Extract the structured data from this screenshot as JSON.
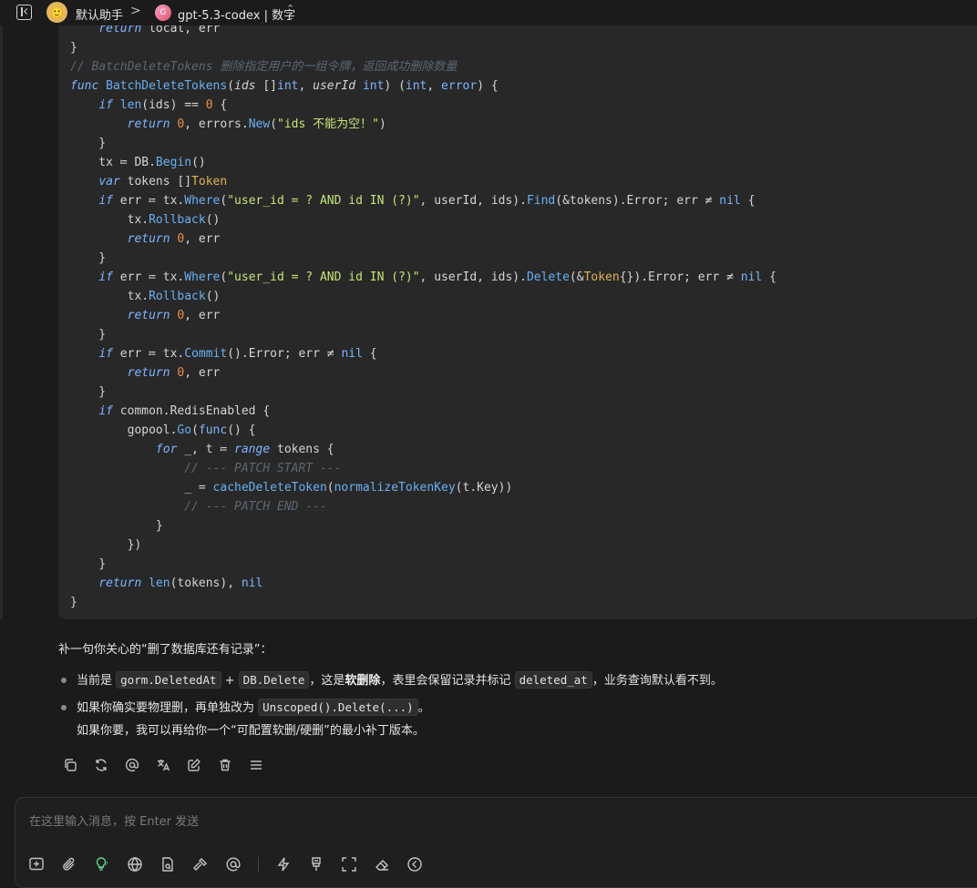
{
  "topbar": {
    "assistant_name": "默认助手",
    "separator": ">",
    "model_name": "gpt-5.3-codex | 数字",
    "model_icon_letter": "G"
  },
  "code": {
    "language": "go",
    "lines": [
      "    return local, err",
      "}",
      "// BatchDeleteTokens 删除指定用户的一组令牌，返回成功删除数量",
      "func BatchDeleteTokens(ids []int, userId int) (int, error) {",
      "    if len(ids) == 0 {",
      "        return 0, errors.New(\"ids 不能为空！\")",
      "    }",
      "    tx := DB.Begin()",
      "    var tokens []Token",
      "    if err := tx.Where(\"user_id = ? AND id IN (?)\", userId, ids).Find(&tokens).Error; err != nil {",
      "        tx.Rollback()",
      "        return 0, err",
      "    }",
      "    if err := tx.Where(\"user_id = ? AND id IN (?)\", userId, ids).Delete(&Token{}).Error; err != nil {",
      "        tx.Rollback()",
      "        return 0, err",
      "    }",
      "    if err := tx.Commit().Error; err != nil {",
      "        return 0, err",
      "    }",
      "    if common.RedisEnabled {",
      "        gopool.Go(func() {",
      "            for _, t := range tokens {",
      "                // --- PATCH START ---",
      "                _ = cacheDeleteToken(normalizeTokenKey(t.Key))",
      "                // --- PATCH END ---",
      "            }",
      "        })",
      "    }",
      "    return len(tokens), nil",
      "}"
    ]
  },
  "message": {
    "intro": "补一句你关心的“删了数据库还有记录”：",
    "bullet1": {
      "prefix": "当前是 ",
      "code1": "gorm.DeletedAt",
      "plus": " + ",
      "code2": "DB.Delete",
      "mid": "，这是",
      "bold": "软删除",
      "mid2": "，表里会保留记录并标记 ",
      "code3": "deleted_at",
      "suffix": "，业务查询默认看不到。"
    },
    "bullet2": {
      "prefix": "如果你确实要物理删，再单独改为 ",
      "code1": "Unscoped().Delete(...)",
      "suffix": "。"
    },
    "followup": "如果你要，我可以再给你一个“可配置软删/硬删”的最小补丁版本。"
  },
  "actions": [
    "copy-icon",
    "regenerate-icon",
    "mention-icon",
    "translate-icon",
    "edit-icon",
    "delete-icon",
    "menu-icon"
  ],
  "input": {
    "placeholder": "在这里输入消息，按 Enter 发送"
  },
  "tools": [
    "new-topic-icon",
    "attachment-icon",
    "reasoning-icon",
    "web-search-icon",
    "knowledge-icon",
    "mcp-tools-icon",
    "mention-model-icon",
    "quick-phrase-icon",
    "clear-icon",
    "expand-icon",
    "eraser-icon",
    "back-icon"
  ]
}
